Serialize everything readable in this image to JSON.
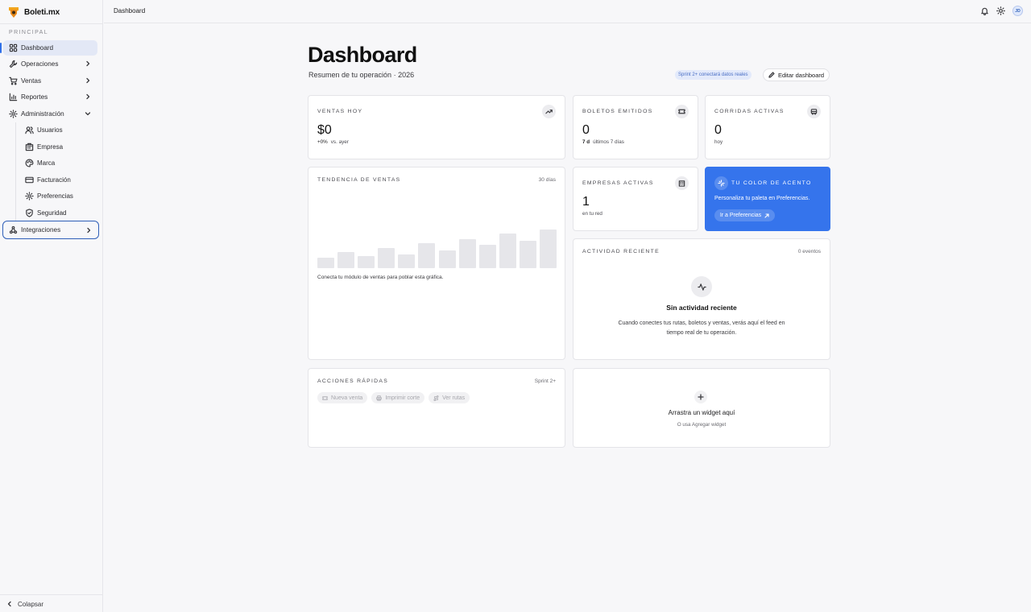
{
  "brand": {
    "name": "Boleti.mx"
  },
  "sidebar": {
    "section_label": "PRINCIPAL",
    "items": [
      {
        "label": "Dashboard",
        "icon": "grid-icon"
      },
      {
        "label": "Operaciones",
        "icon": "wrench-icon"
      },
      {
        "label": "Ventas",
        "icon": "cart-icon"
      },
      {
        "label": "Reportes",
        "icon": "bar-chart-icon"
      },
      {
        "label": "Administración",
        "icon": "gear-icon"
      }
    ],
    "admin_sub": [
      {
        "label": "Usuarios",
        "icon": "users-icon"
      },
      {
        "label": "Empresa",
        "icon": "building-icon"
      },
      {
        "label": "Marca",
        "icon": "palette-icon"
      },
      {
        "label": "Facturación",
        "icon": "card-icon"
      },
      {
        "label": "Preferencias",
        "icon": "gear-icon"
      },
      {
        "label": "Seguridad",
        "icon": "shield-icon"
      }
    ],
    "integrations": {
      "label": "Integraciones",
      "icon": "webhook-icon"
    },
    "collapse_label": "Colapsar"
  },
  "topbar": {
    "breadcrumb": "Dashboard",
    "avatar_initials": "JD"
  },
  "header": {
    "title": "Dashboard",
    "subtitle": "Resumen de tu operación · 2026",
    "sprint_badge": "Sprint 2+ conectará datos reales",
    "edit_button": "Editar dashboard"
  },
  "cards": {
    "ventas": {
      "label": "VENTAS HOY",
      "value": "$0",
      "delta": "+0%",
      "foot": "vs. ayer"
    },
    "boletos": {
      "label": "BOLETOS EMITIDOS",
      "value": "0",
      "period": "7 d",
      "foot": "últimos 7 días"
    },
    "corridas": {
      "label": "CORRIDAS ACTIVAS",
      "value": "0",
      "foot": "hoy"
    },
    "empresas": {
      "label": "EMPRESAS ACTIVAS",
      "value": "1",
      "foot": "en tu red"
    },
    "acento": {
      "label": "TU COLOR DE ACENTO",
      "text": "Personaliza tu paleta en Preferencias.",
      "button": "Ir a Preferencias",
      "color": "#3574ec"
    },
    "tendencia": {
      "label": "TENDENCIA DE VENTAS",
      "range": "30 días",
      "caption": "Conecta tu módulo de ventas para poblar esta gráfica."
    },
    "actividad": {
      "label": "ACTIVIDAD RECIENTE",
      "count": "0 eventos",
      "empty_title": "Sin actividad reciente",
      "empty_body": "Cuando conectes tus rutas, boletos y ventas, verás aquí el feed en tiempo real de tu operación."
    },
    "acciones": {
      "label": "ACCIONES RÁPIDAS",
      "tag": "Sprint 2+",
      "buttons": [
        "Nueva venta",
        "Imprimir corte",
        "Ver rutas"
      ]
    },
    "widget": {
      "title": "Arrastra un widget aquí",
      "sub": "O usa Agregar widget"
    }
  },
  "chart_data": {
    "type": "bar",
    "values": [
      13,
      20,
      15,
      25,
      17,
      31,
      22,
      36,
      29,
      43,
      34,
      48
    ],
    "ylim": [
      0,
      50
    ]
  }
}
